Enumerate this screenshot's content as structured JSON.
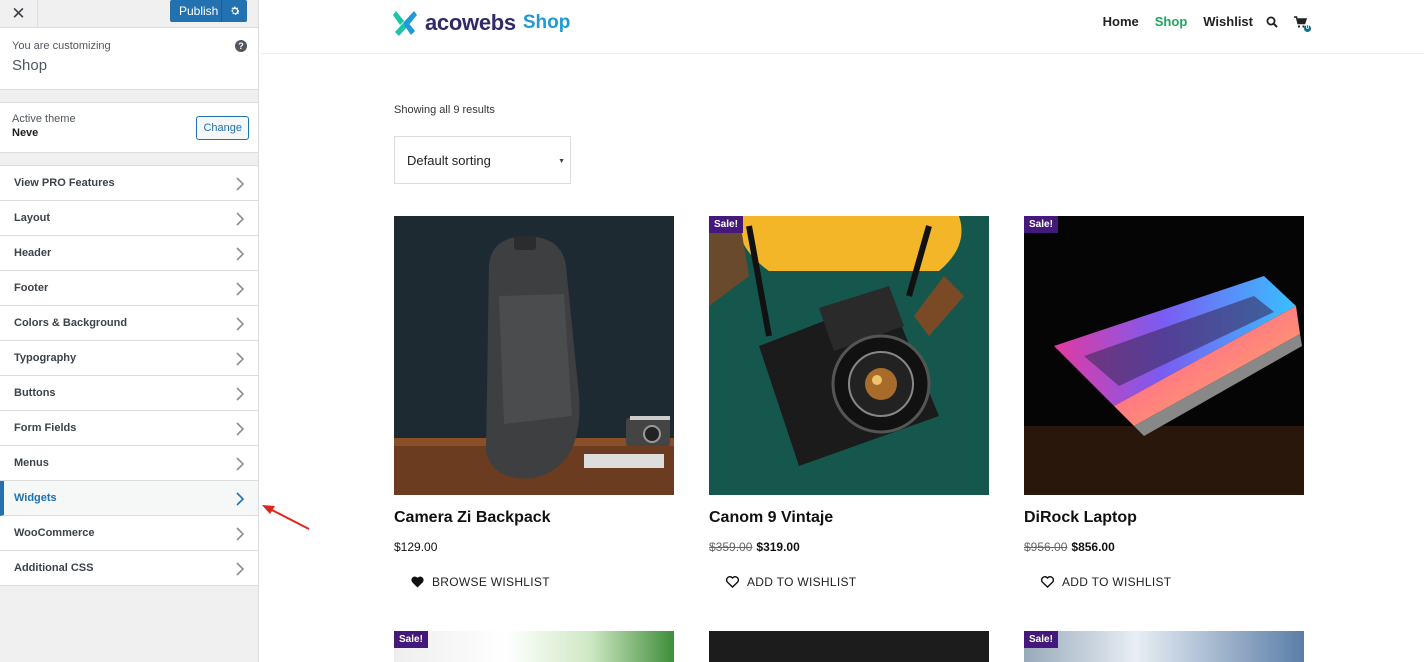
{
  "topbar": {
    "close_symbol": "✕",
    "publish_label": "Publish",
    "gear_icon": "gear-icon"
  },
  "customizing": {
    "subtitle": "You are customizing",
    "title": "Shop"
  },
  "theme": {
    "label": "Active theme",
    "name": "Neve",
    "change_label": "Change"
  },
  "menu": {
    "items": [
      {
        "label": "View PRO Features"
      },
      {
        "label": "Layout"
      },
      {
        "label": "Header"
      },
      {
        "label": "Footer"
      },
      {
        "label": "Colors & Background"
      },
      {
        "label": "Typography"
      },
      {
        "label": "Buttons"
      },
      {
        "label": "Form Fields"
      },
      {
        "label": "Menus"
      },
      {
        "label": "Widgets"
      },
      {
        "label": "WooCommerce"
      },
      {
        "label": "Additional CSS"
      }
    ],
    "active_index": 9
  },
  "site": {
    "logo_text": "acowebs",
    "logo_accent": "Shop",
    "nav": [
      "Home",
      "Shop",
      "Wishlist"
    ],
    "cart_count": "0",
    "results_text": "Showing all 9 results",
    "sort_value": "Default sorting",
    "colors": {
      "accent": "#1ea65b",
      "sale_badge": "#45197b",
      "logo": "#2e2b66",
      "logo_accent": "#1e9ad6"
    }
  },
  "products": [
    {
      "name": "Camera Zi Backpack",
      "price": "$129.00",
      "old_price": "",
      "new_price": "",
      "sale": "",
      "wish": "BROWSE WISHLIST"
    },
    {
      "name": "Canom 9 Vintaje",
      "price": "",
      "old_price": "$359.00",
      "new_price": "$319.00",
      "sale": "Sale!",
      "wish": "ADD TO WISHLIST"
    },
    {
      "name": "DiRock Laptop",
      "price": "",
      "old_price": "$956.00",
      "new_price": "$856.00",
      "sale": "Sale!",
      "wish": "ADD TO WISHLIST"
    }
  ],
  "row2": [
    {
      "sale": "Sale!"
    },
    {
      "sale": ""
    },
    {
      "sale": "Sale!"
    }
  ]
}
